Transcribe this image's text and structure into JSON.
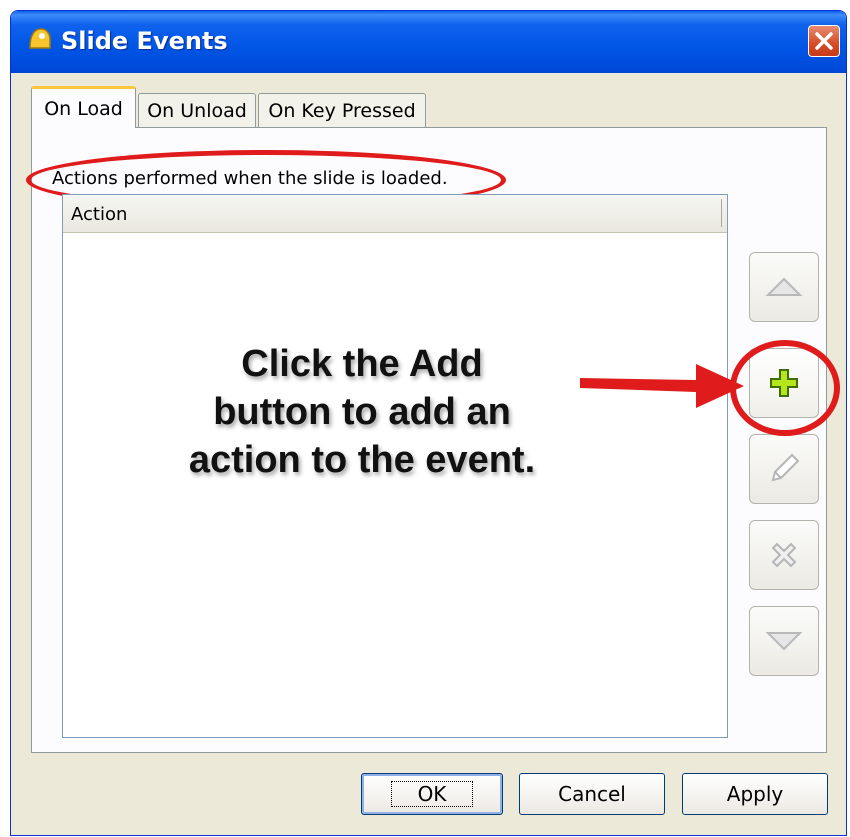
{
  "window": {
    "title": "Slide Events"
  },
  "icons": {
    "app": "app-icon",
    "close": "close-icon",
    "up": "arrow-up-icon",
    "add": "plus-icon",
    "edit": "pencil-icon",
    "delete": "x-icon",
    "down": "arrow-down-icon"
  },
  "tabs": [
    {
      "label": "On Load",
      "active": true
    },
    {
      "label": "On Unload",
      "active": false
    },
    {
      "label": "On Key Pressed",
      "active": false
    }
  ],
  "panel": {
    "description": "Actions performed when the slide is loaded.",
    "table": {
      "columns": [
        "Action"
      ],
      "rows": []
    }
  },
  "annotation": {
    "lines": [
      "Click the Add",
      "button to add an",
      "action to the event."
    ]
  },
  "footer": {
    "ok": "OK",
    "cancel": "Cancel",
    "apply": "Apply"
  },
  "colors": {
    "title_bar": "#0055e5",
    "annotation_red": "#e01b1b",
    "add_green": "#9acd32"
  }
}
